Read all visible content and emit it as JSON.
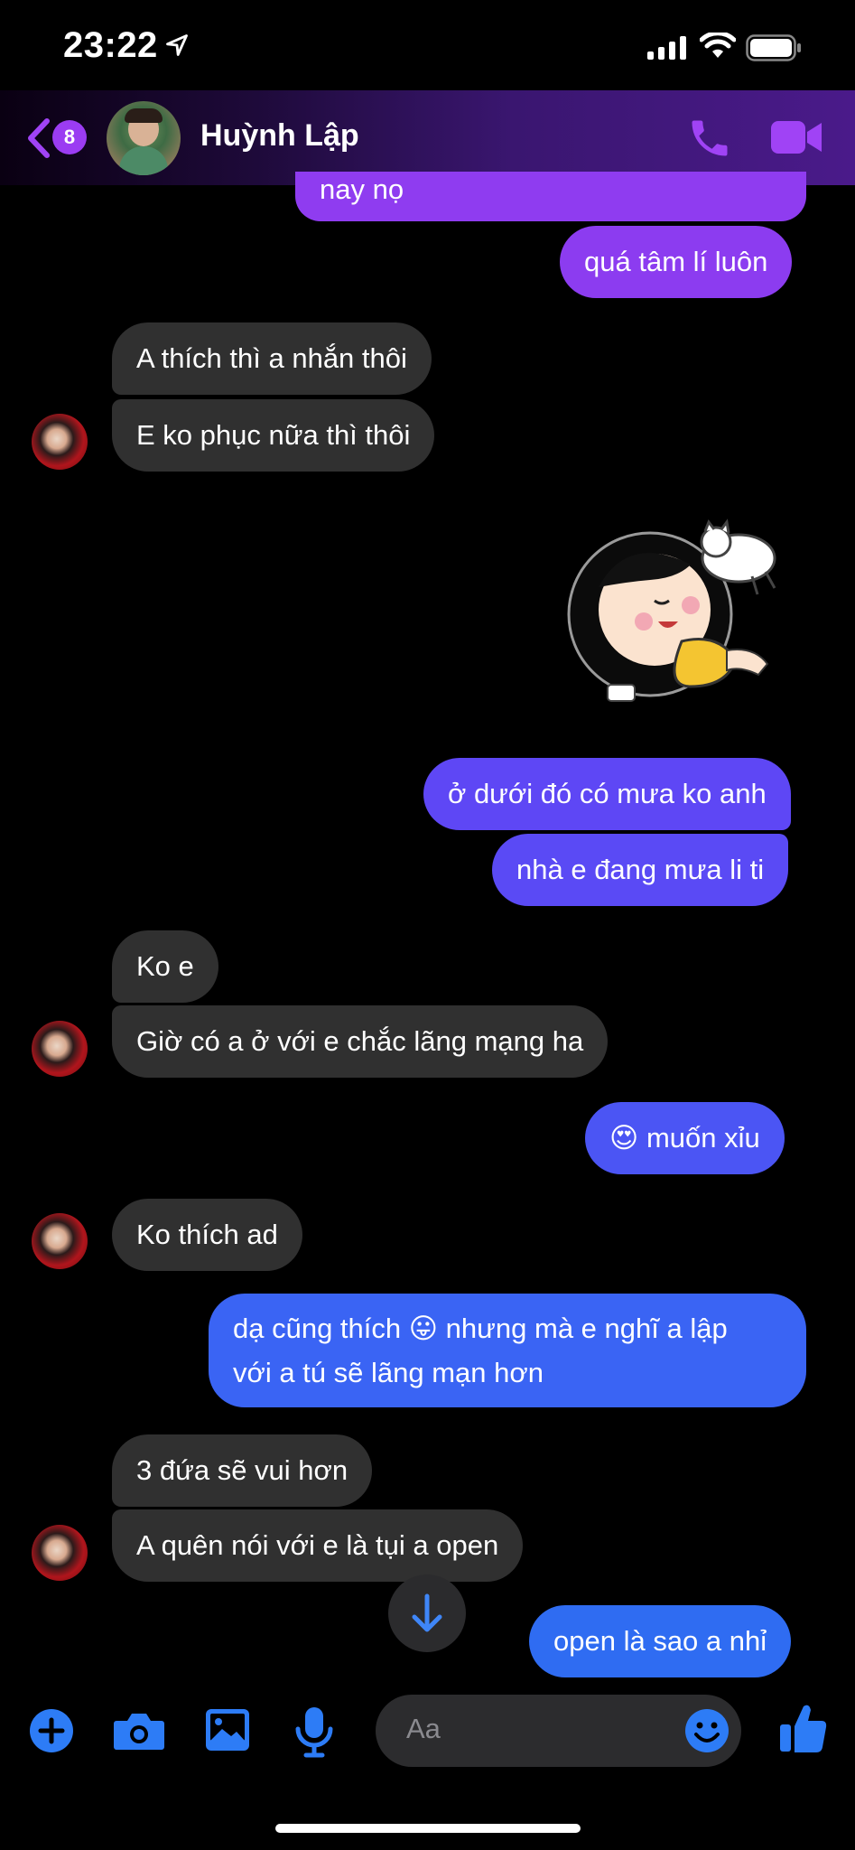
{
  "status_bar": {
    "time": "23:22"
  },
  "header": {
    "back_badge_count": "8",
    "contact_name": "Huỳnh Lập"
  },
  "messages": [
    {
      "from": "me",
      "text": "nay nọ"
    },
    {
      "from": "me",
      "text": "quá tâm lí luôn"
    },
    {
      "from": "them",
      "text": "A thích thì a nhắn thôi"
    },
    {
      "from": "them",
      "text": "E ko phục nữa thì thôi"
    },
    {
      "from": "me",
      "type": "sticker",
      "sticker": "sleeping-girl-with-cat-sticker"
    },
    {
      "from": "me",
      "text": "ở dưới đó có mưa ko anh"
    },
    {
      "from": "me",
      "text": "nhà e đang mưa li ti"
    },
    {
      "from": "them",
      "text": "Ko e"
    },
    {
      "from": "them",
      "text": "Giờ có a ở với e chắc lãng mạng ha"
    },
    {
      "from": "me",
      "text": "muốn xỉu",
      "emoji": "😍"
    },
    {
      "from": "them",
      "text": "Ko thích ad"
    },
    {
      "from": "me",
      "text_line1": "dạ cũng thích 😛 nhưng mà e nghĩ a lập",
      "text_line2": "với a tú sẽ lãng mạn hơn"
    },
    {
      "from": "them",
      "text": "3 đứa sẽ vui hơn"
    },
    {
      "from": "them",
      "text": "A quên nói với e là tụi a open"
    },
    {
      "from": "me",
      "text": "open là sao a nhỉ"
    }
  ],
  "composer": {
    "placeholder": "Aa"
  },
  "colors": {
    "accent": "#a043f5",
    "bubble_in": "#303030",
    "bubble_out_top": "#8e3bf0",
    "bubble_out_mid": "#5b4af5",
    "bubble_out_bottom": "#2f6bf2",
    "toolbar_blue": "#2d7cf6"
  },
  "icons": [
    "navigation-arrow-icon",
    "signal-icon",
    "wifi-icon",
    "battery-icon",
    "back-chevron-icon",
    "phone-icon",
    "video-icon",
    "plus-icon",
    "camera-icon",
    "image-icon",
    "microphone-icon",
    "emoji-icon",
    "thumbs-up-icon",
    "arrow-down-icon"
  ]
}
